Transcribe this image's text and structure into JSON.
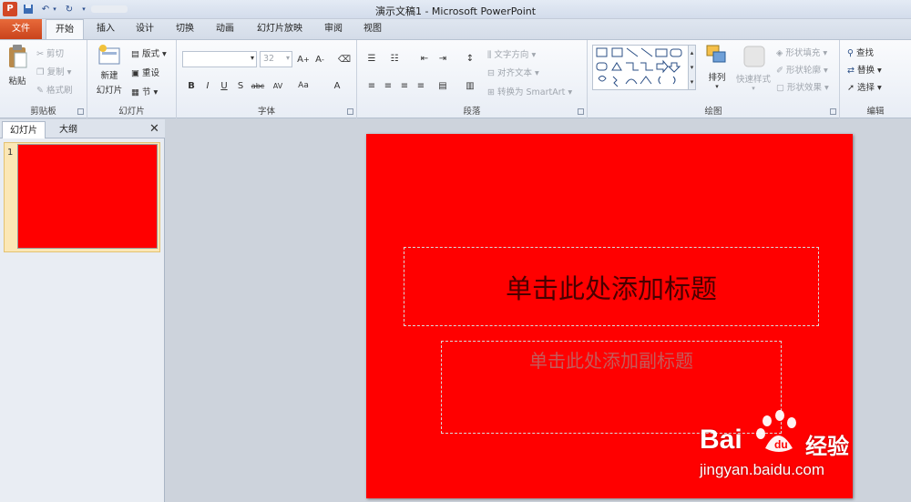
{
  "window": {
    "title": "演示文稿1 - Microsoft PowerPoint"
  },
  "qat": {
    "app_icon": "P"
  },
  "tabs": [
    "文件",
    "开始",
    "插入",
    "设计",
    "切换",
    "动画",
    "幻灯片放映",
    "审阅",
    "视图"
  ],
  "ribbon": {
    "clipboard": {
      "label": "剪贴板",
      "paste": "粘贴",
      "cut": "剪切",
      "copy": "复制",
      "format_painter": "格式刷"
    },
    "slides": {
      "label": "幻灯片",
      "new_slide": "新建",
      "new_slide2": "幻灯片",
      "layout": "版式",
      "reset": "重设",
      "section": "节"
    },
    "font": {
      "label": "字体",
      "font_name": "",
      "font_size": "32"
    },
    "paragraph": {
      "label": "段落",
      "text_direction": "文字方向",
      "align_text": "对齐文本",
      "convert_smartart": "转换为 SmartArt"
    },
    "drawing": {
      "label": "绘图",
      "arrange": "排列",
      "quick_styles": "快速样式",
      "shape_fill": "形状填充",
      "shape_outline": "形状轮廓",
      "shape_effects": "形状效果"
    },
    "editing": {
      "label": "编辑",
      "find": "查找",
      "replace": "替换",
      "select": "选择"
    }
  },
  "panel": {
    "tab_slides": "幻灯片",
    "tab_outline": "大纲",
    "slide_number": "1"
  },
  "slide": {
    "title_placeholder": "单击此处添加标题",
    "subtitle_placeholder": "单击此处添加副标题",
    "background": "#ff0000"
  },
  "watermark": {
    "brand_left": "Bai",
    "brand_right": "经验",
    "url": "jingyan.baidu.com"
  }
}
